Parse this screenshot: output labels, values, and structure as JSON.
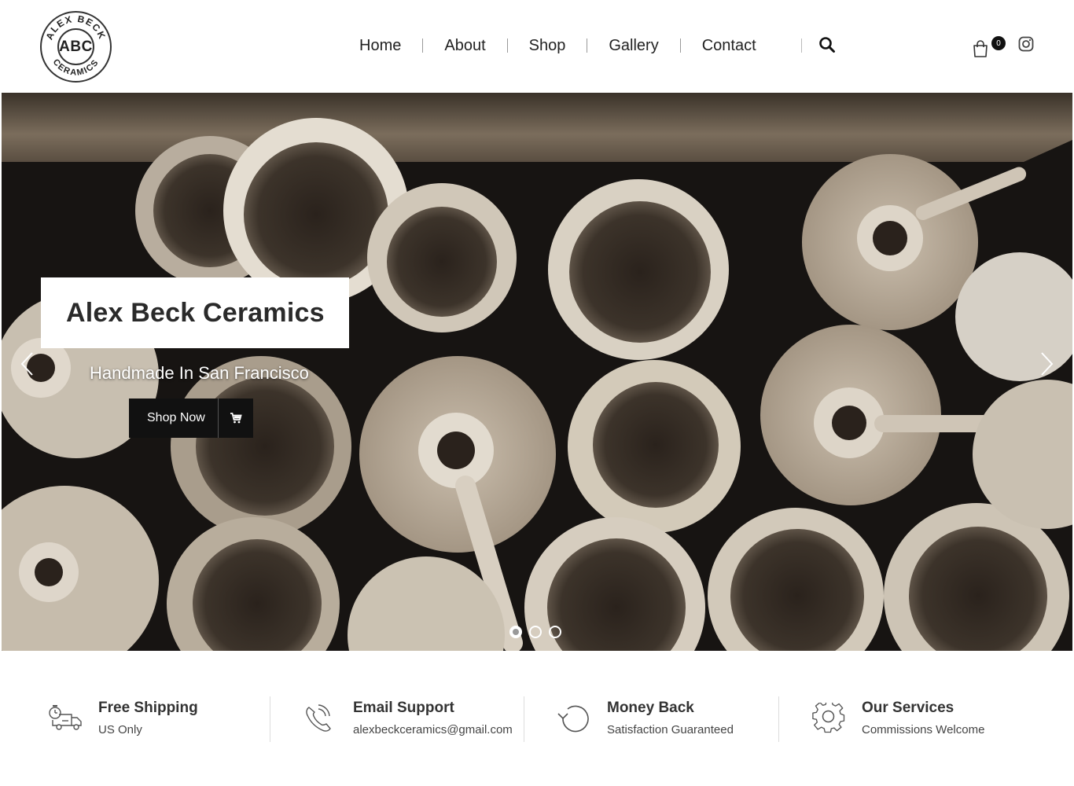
{
  "logo": {
    "text": "ABC",
    "ring_text": "ALEX BECK CERAMICS"
  },
  "nav": {
    "items": [
      {
        "label": "Home"
      },
      {
        "label": "About"
      },
      {
        "label": "Shop"
      },
      {
        "label": "Gallery"
      },
      {
        "label": "Contact"
      }
    ]
  },
  "header_tools": {
    "cart_count": "0",
    "icons": [
      "search-icon",
      "shopping-bag-icon",
      "instagram-icon"
    ]
  },
  "hero": {
    "title": "Alex Beck Ceramics",
    "subtitle": "Handmade In San Francisco",
    "cta_label": "Shop Now",
    "slide_count": 3,
    "active_slide": 1
  },
  "features": [
    {
      "icon": "delivery-truck-icon",
      "title": "Free Shipping",
      "subtitle": "US Only"
    },
    {
      "icon": "phone-icon",
      "title": "Email Support",
      "subtitle": "alexbeckceramics@gmail.com"
    },
    {
      "icon": "refresh-icon",
      "title": "Money Back",
      "subtitle": "Satisfaction Guaranteed"
    },
    {
      "icon": "gear-icon",
      "title": "Our Services",
      "subtitle": "Commissions Welcome"
    }
  ],
  "colors": {
    "accent": "#111111",
    "text": "#222222",
    "hero_bg": "#141211",
    "clay": "#d9d1c3"
  }
}
